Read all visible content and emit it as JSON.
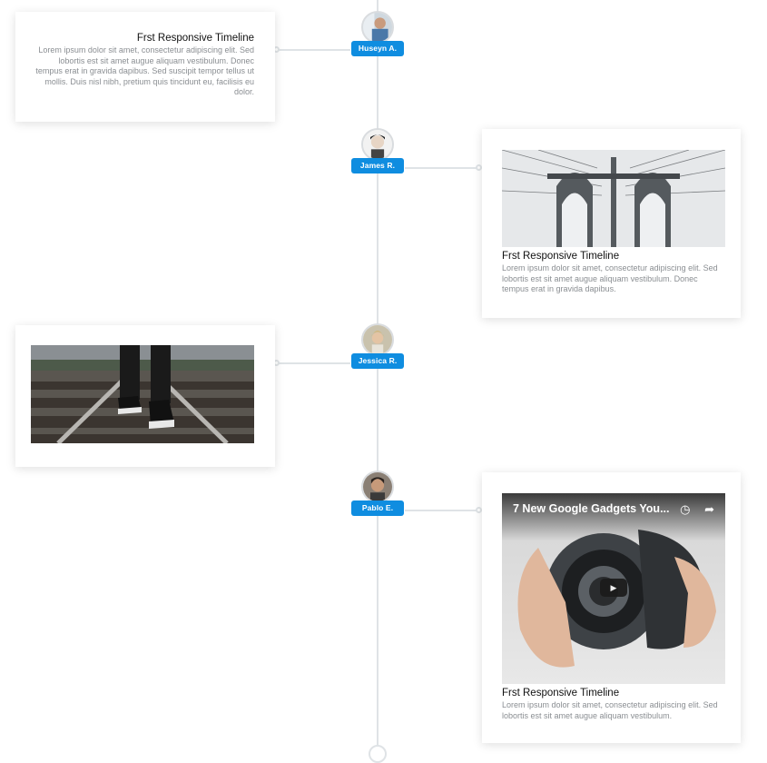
{
  "timeline": {
    "items": [
      {
        "author": "Huseyn A.",
        "side": "left",
        "title": "Frst Responsive Timeline",
        "text": "Lorem ipsum dolor sit amet, consectetur adipiscing elit. Sed lobortis est sit amet augue aliquam vestibulum. Donec tempus erat in gravida dapibus. Sed suscipit tempor tellus ut mollis. Duis nisl nibh, pretium quis tincidunt eu, facilisis eu dolor."
      },
      {
        "author": "James R.",
        "side": "right",
        "media": "bridge-photo",
        "title": "Frst Responsive Timeline",
        "text": "Lorem ipsum dolor sit amet, consectetur adipiscing elit. Sed lobortis est sit amet augue aliquam vestibulum. Donec tempus erat in gravida dapibus."
      },
      {
        "author": "Jessica R.",
        "side": "left",
        "media": "railway-sneakers-photo"
      },
      {
        "author": "Pablo E.",
        "side": "right",
        "media": "video-embed",
        "video_title": "7 New Google Gadgets You...",
        "title": "Frst Responsive Timeline",
        "text": "Lorem ipsum dolor sit amet, consectetur adipiscing elit. Sed lobortis est sit amet augue aliquam vestibulum."
      }
    ]
  },
  "colors": {
    "accent": "#0f8de0",
    "axis": "#dfe3e6"
  },
  "icons": {
    "clock": "clock-icon",
    "share": "share-icon",
    "play": "play-icon"
  }
}
